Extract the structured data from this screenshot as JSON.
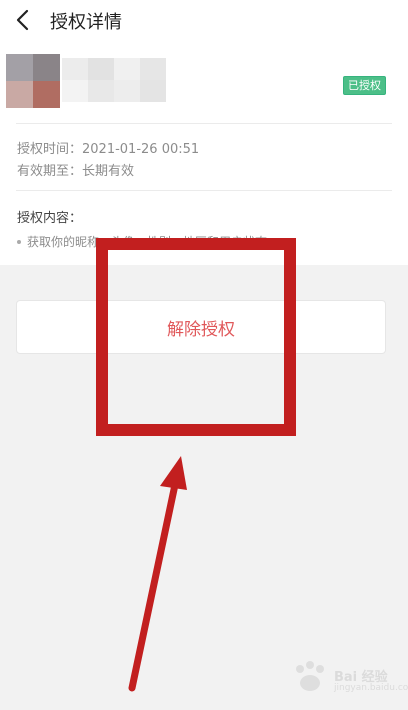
{
  "nav": {
    "title": "授权详情"
  },
  "app": {
    "badge": "已授权"
  },
  "auth": {
    "time_label": "授权时间：",
    "time_value": "2021-01-26 00:51",
    "expiry_label": "有效期至：",
    "expiry_value": "长期有效"
  },
  "permissions": {
    "title": "授权内容：",
    "item": "获取你的昵称、头像、性别、地区和用户状态"
  },
  "actions": {
    "revoke_label": "解除授权"
  },
  "watermark": {
    "brand": "Bai 经验",
    "url": "jingyan.baidu.com"
  },
  "colors": {
    "accent_red": "#c21f1f",
    "revoke_text": "#e0585a",
    "badge_green": "#4cbf88"
  }
}
